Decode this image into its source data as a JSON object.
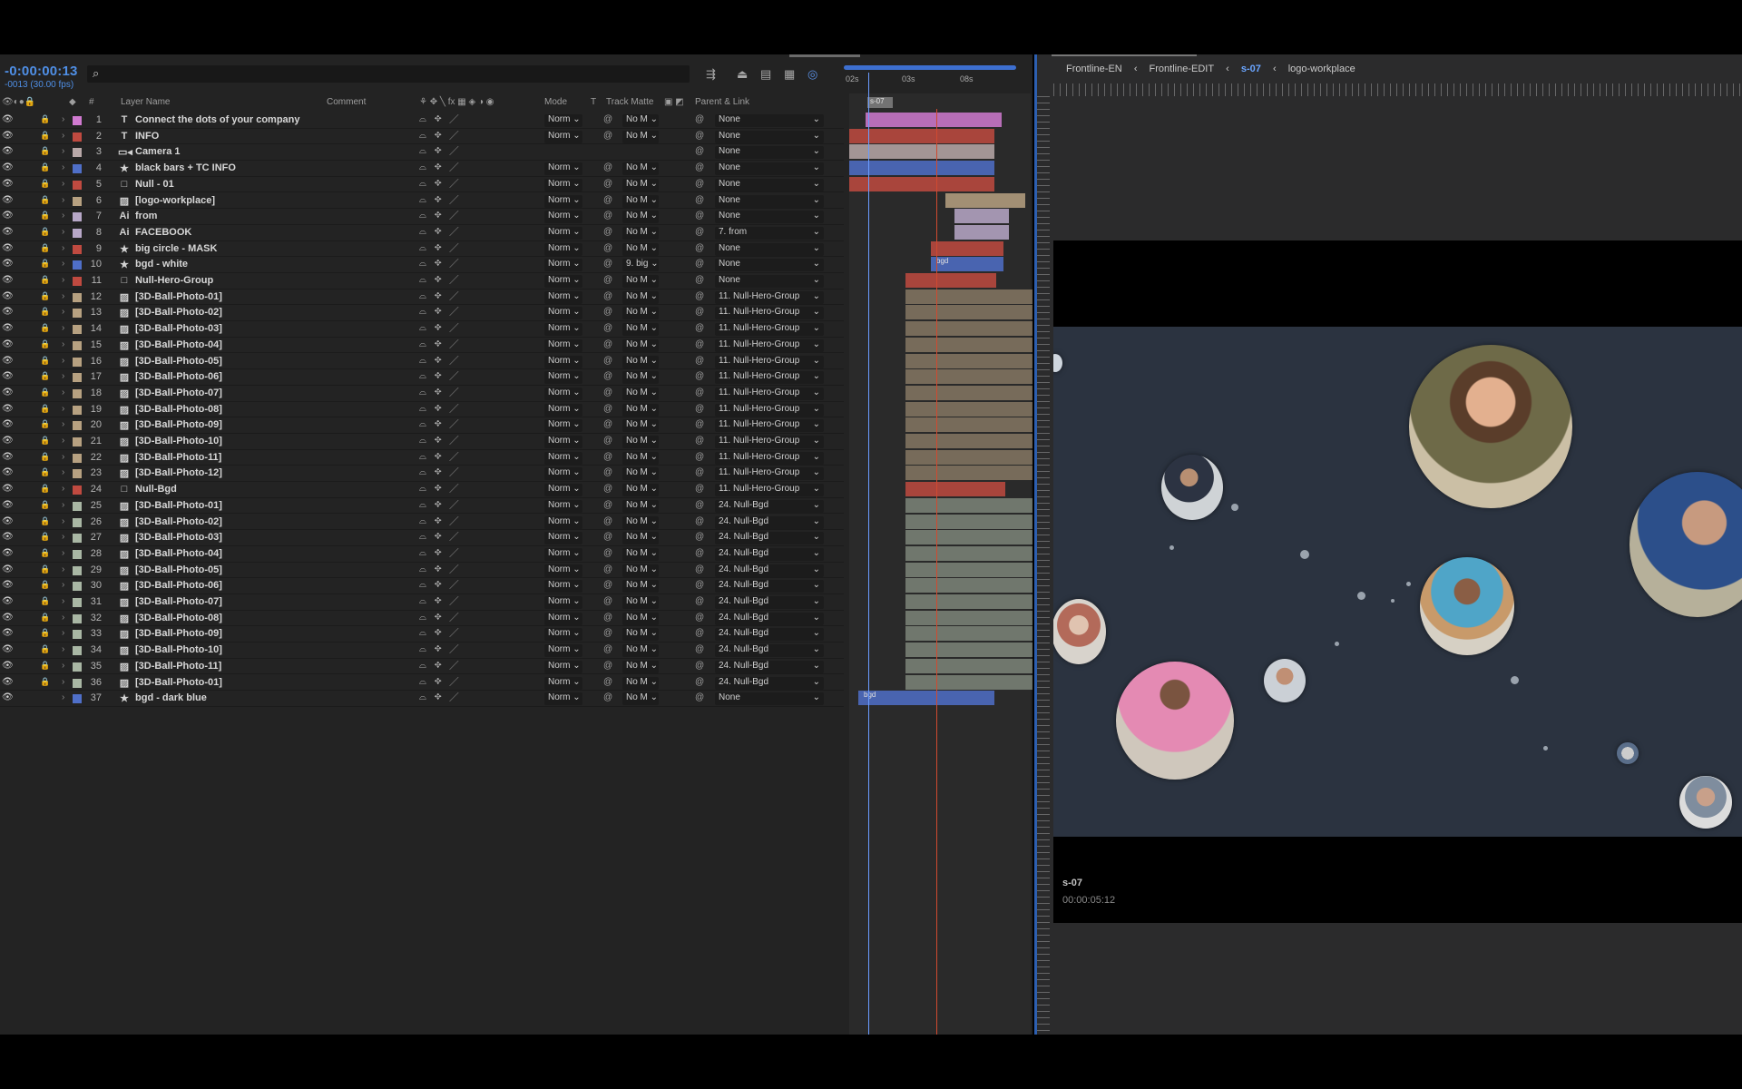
{
  "timeline": {
    "timecode": "-0:00:00:13",
    "fps": "-0013 (30.00 fps)",
    "headers": {
      "num": "#",
      "layer_name": "Layer Name",
      "comment": "Comment",
      "mode": "Mode",
      "t": "T",
      "track_matte": "Track Matte",
      "parent_link": "Parent & Link"
    },
    "ruler": {
      "t1": "02s",
      "t2": "03s",
      "t3": "08s",
      "marker": "s-07"
    },
    "layers": [
      {
        "num": "1",
        "icon": "T",
        "name": "Connect the dots of your company",
        "label": "#d07ad0",
        "mode": "Norm",
        "matte": "No M",
        "parent": "None"
      },
      {
        "num": "2",
        "icon": "T",
        "name": "INFO",
        "label": "#c04a40",
        "mode": "Norm",
        "matte": "No M",
        "parent": "None"
      },
      {
        "num": "3",
        "icon": "cam",
        "name": "Camera 1",
        "label": "#b8a8a8",
        "mode": "",
        "matte": "",
        "parent": "None"
      },
      {
        "num": "4",
        "icon": "★",
        "name": "black bars + TC INFO",
        "label": "#4f6fc8",
        "mode": "Norm",
        "matte": "No M",
        "parent": "None"
      },
      {
        "num": "5",
        "icon": "□",
        "name": "Null - 01",
        "label": "#c04a40",
        "mode": "Norm",
        "matte": "No M",
        "parent": "None"
      },
      {
        "num": "6",
        "icon": "img",
        "name": "[logo-workplace]",
        "label": "#b7a181",
        "mode": "Norm",
        "matte": "No M",
        "parent": "None"
      },
      {
        "num": "7",
        "icon": "ai",
        "name": "from",
        "label": "#b8a8c8",
        "mode": "Norm",
        "matte": "No M",
        "parent": "None"
      },
      {
        "num": "8",
        "icon": "ai",
        "name": "FACEBOOK",
        "label": "#b8a8c8",
        "mode": "Norm",
        "matte": "No M",
        "parent": "7. from"
      },
      {
        "num": "9",
        "icon": "★",
        "name": "big circle - MASK",
        "label": "#c04a40",
        "mode": "Norm",
        "matte": "No M",
        "parent": "None"
      },
      {
        "num": "10",
        "icon": "★",
        "name": "bgd - white",
        "label": "#4f6fc8",
        "mode": "Norm",
        "matte": "9. big",
        "parent": "None"
      },
      {
        "num": "11",
        "icon": "□",
        "name": "Null-Hero-Group",
        "label": "#c04a40",
        "mode": "Norm",
        "matte": "No M",
        "parent": "None"
      },
      {
        "num": "12",
        "icon": "img",
        "name": "[3D-Ball-Photo-01]",
        "label": "#b7a181",
        "mode": "Norm",
        "matte": "No M",
        "parent": "11. Null-Hero-Group"
      },
      {
        "num": "13",
        "icon": "img",
        "name": "[3D-Ball-Photo-02]",
        "label": "#b7a181",
        "mode": "Norm",
        "matte": "No M",
        "parent": "11. Null-Hero-Group"
      },
      {
        "num": "14",
        "icon": "img",
        "name": "[3D-Ball-Photo-03]",
        "label": "#b7a181",
        "mode": "Norm",
        "matte": "No M",
        "parent": "11. Null-Hero-Group"
      },
      {
        "num": "15",
        "icon": "img",
        "name": "[3D-Ball-Photo-04]",
        "label": "#b7a181",
        "mode": "Norm",
        "matte": "No M",
        "parent": "11. Null-Hero-Group"
      },
      {
        "num": "16",
        "icon": "img",
        "name": "[3D-Ball-Photo-05]",
        "label": "#b7a181",
        "mode": "Norm",
        "matte": "No M",
        "parent": "11. Null-Hero-Group"
      },
      {
        "num": "17",
        "icon": "img",
        "name": "[3D-Ball-Photo-06]",
        "label": "#b7a181",
        "mode": "Norm",
        "matte": "No M",
        "parent": "11. Null-Hero-Group"
      },
      {
        "num": "18",
        "icon": "img",
        "name": "[3D-Ball-Photo-07]",
        "label": "#b7a181",
        "mode": "Norm",
        "matte": "No M",
        "parent": "11. Null-Hero-Group"
      },
      {
        "num": "19",
        "icon": "img",
        "name": "[3D-Ball-Photo-08]",
        "label": "#b7a181",
        "mode": "Norm",
        "matte": "No M",
        "parent": "11. Null-Hero-Group"
      },
      {
        "num": "20",
        "icon": "img",
        "name": "[3D-Ball-Photo-09]",
        "label": "#b7a181",
        "mode": "Norm",
        "matte": "No M",
        "parent": "11. Null-Hero-Group"
      },
      {
        "num": "21",
        "icon": "img",
        "name": "[3D-Ball-Photo-10]",
        "label": "#b7a181",
        "mode": "Norm",
        "matte": "No M",
        "parent": "11. Null-Hero-Group"
      },
      {
        "num": "22",
        "icon": "img",
        "name": "[3D-Ball-Photo-11]",
        "label": "#b7a181",
        "mode": "Norm",
        "matte": "No M",
        "parent": "11. Null-Hero-Group"
      },
      {
        "num": "23",
        "icon": "img",
        "name": "[3D-Ball-Photo-12]",
        "label": "#b7a181",
        "mode": "Norm",
        "matte": "No M",
        "parent": "11. Null-Hero-Group"
      },
      {
        "num": "24",
        "icon": "□",
        "name": "Null-Bgd",
        "label": "#c04a40",
        "mode": "Norm",
        "matte": "No M",
        "parent": "11. Null-Hero-Group"
      },
      {
        "num": "25",
        "icon": "img",
        "name": "[3D-Ball-Photo-01]",
        "label": "#a9b7a4",
        "mode": "Norm",
        "matte": "No M",
        "parent": "24. Null-Bgd"
      },
      {
        "num": "26",
        "icon": "img",
        "name": "[3D-Ball-Photo-02]",
        "label": "#a9b7a4",
        "mode": "Norm",
        "matte": "No M",
        "parent": "24. Null-Bgd"
      },
      {
        "num": "27",
        "icon": "img",
        "name": "[3D-Ball-Photo-03]",
        "label": "#a9b7a4",
        "mode": "Norm",
        "matte": "No M",
        "parent": "24. Null-Bgd"
      },
      {
        "num": "28",
        "icon": "img",
        "name": "[3D-Ball-Photo-04]",
        "label": "#a9b7a4",
        "mode": "Norm",
        "matte": "No M",
        "parent": "24. Null-Bgd"
      },
      {
        "num": "29",
        "icon": "img",
        "name": "[3D-Ball-Photo-05]",
        "label": "#a9b7a4",
        "mode": "Norm",
        "matte": "No M",
        "parent": "24. Null-Bgd"
      },
      {
        "num": "30",
        "icon": "img",
        "name": "[3D-Ball-Photo-06]",
        "label": "#a9b7a4",
        "mode": "Norm",
        "matte": "No M",
        "parent": "24. Null-Bgd"
      },
      {
        "num": "31",
        "icon": "img",
        "name": "[3D-Ball-Photo-07]",
        "label": "#a9b7a4",
        "mode": "Norm",
        "matte": "No M",
        "parent": "24. Null-Bgd"
      },
      {
        "num": "32",
        "icon": "img",
        "name": "[3D-Ball-Photo-08]",
        "label": "#a9b7a4",
        "mode": "Norm",
        "matte": "No M",
        "parent": "24. Null-Bgd"
      },
      {
        "num": "33",
        "icon": "img",
        "name": "[3D-Ball-Photo-09]",
        "label": "#a9b7a4",
        "mode": "Norm",
        "matte": "No M",
        "parent": "24. Null-Bgd"
      },
      {
        "num": "34",
        "icon": "img",
        "name": "[3D-Ball-Photo-10]",
        "label": "#a9b7a4",
        "mode": "Norm",
        "matte": "No M",
        "parent": "24. Null-Bgd"
      },
      {
        "num": "35",
        "icon": "img",
        "name": "[3D-Ball-Photo-11]",
        "label": "#a9b7a4",
        "mode": "Norm",
        "matte": "No M",
        "parent": "24. Null-Bgd"
      },
      {
        "num": "36",
        "icon": "img",
        "name": "[3D-Ball-Photo-01]",
        "label": "#a9b7a4",
        "mode": "Norm",
        "matte": "No M",
        "parent": "24. Null-Bgd"
      },
      {
        "num": "37",
        "icon": "★",
        "name": "bgd - dark blue",
        "label": "#4f6fc8",
        "mode": "Norm",
        "matte": "No M",
        "parent": "None"
      }
    ],
    "bar_labels": {
      "bgd_white": "bgd",
      "bgd_dark": "bgd"
    }
  },
  "comp": {
    "breadcrumbs": [
      "Frontline-EN",
      "Frontline-EDIT",
      "s-07",
      "logo-workplace"
    ],
    "active_crumb": "s-07",
    "overlay_name": "s-07",
    "overlay_timecode": "00:00:05:12",
    "background": "#2b3340"
  },
  "colors": {
    "accent": "#4f8fe6",
    "playhead": "#6b9cff",
    "cti_red": "#d04a30"
  }
}
